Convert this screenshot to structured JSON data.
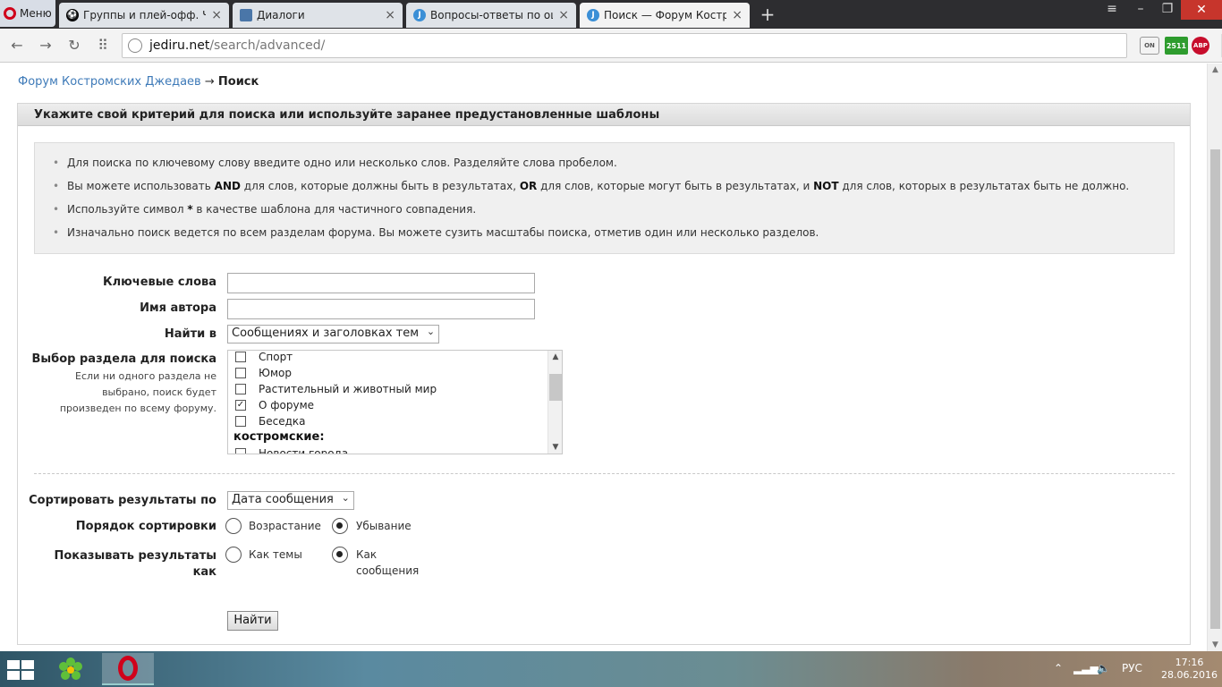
{
  "browser": {
    "menu_label": "Меню",
    "tabs": [
      {
        "title": "Группы и плей-офф. Чемп",
        "icon": "soccer-ball-icon"
      },
      {
        "title": "Диалоги",
        "icon": "vk-chat-icon"
      },
      {
        "title": "Вопросы-ответы по оши",
        "icon": "jediru-icon"
      },
      {
        "title": "Поиск — Форум Костром",
        "icon": "jediru-icon"
      }
    ],
    "url_host": "jediru.net",
    "url_path": "/search/advanced/",
    "ext_abp": "ABP",
    "ext_j": "2511",
    "ext_on": "ON"
  },
  "breadcrumb": {
    "forum": "Форум Костромских Джедаев",
    "sep": "→",
    "current": "Поиск"
  },
  "panel": {
    "title": "Укажите свой критерий для поиска или используйте заранее предустановленные шаблоны"
  },
  "tips": {
    "t1": "Для поиска по ключевому слову введите одно или несколько слов. Разделяйте слова пробелом.",
    "t2a": "Вы можете использовать ",
    "t2_and": "AND",
    "t2b": " для слов, которые должны быть в результатах, ",
    "t2_or": "OR",
    "t2c": " для слов, которые могут быть в результатах, и ",
    "t2_not": "NOT",
    "t2d": " для слов, которых в результатах быть не должно.",
    "t3a": "Используйте символ ",
    "t3_star": "*",
    "t3b": " в качестве шаблона для частичного совпадения.",
    "t4": "Изначально поиск ведется по всем разделам форума. Вы можете сузить масштабы поиска, отметив один или несколько разделов."
  },
  "form": {
    "keywords_label": "Ключевые слова",
    "keywords_value": "",
    "author_label": "Имя автора",
    "author_value": "",
    "search_in_label": "Найти в",
    "search_in_value": "Сообщениях и заголовках тем",
    "section_label": "Выбор раздела для поиска",
    "section_desc": "Если ни одного раздела не выбрано, поиск будет произведен по всему форуму.",
    "sections": [
      {
        "label": "Спорт",
        "checked": false
      },
      {
        "label": "Юмор",
        "checked": false
      },
      {
        "label": "Растительный и животный мир",
        "checked": false
      },
      {
        "label": "О форуме",
        "checked": true
      },
      {
        "label": "Беседка",
        "checked": false
      }
    ],
    "group_label": "костромские:",
    "next_section": "Новости города",
    "sort_label": "Сортировать результаты по",
    "sort_value": "Дата сообщения",
    "order_label": "Порядок сортировки",
    "order_asc": "Возрастание",
    "order_desc": "Убывание",
    "order_selected": "desc",
    "show_label": "Показывать результаты как",
    "show_topics": "Как темы",
    "show_posts": "Как сообщения",
    "show_selected": "posts",
    "submit": "Найти"
  },
  "taskbar": {
    "lang": "РУС",
    "time": "17:16",
    "date": "28.06.2016"
  }
}
